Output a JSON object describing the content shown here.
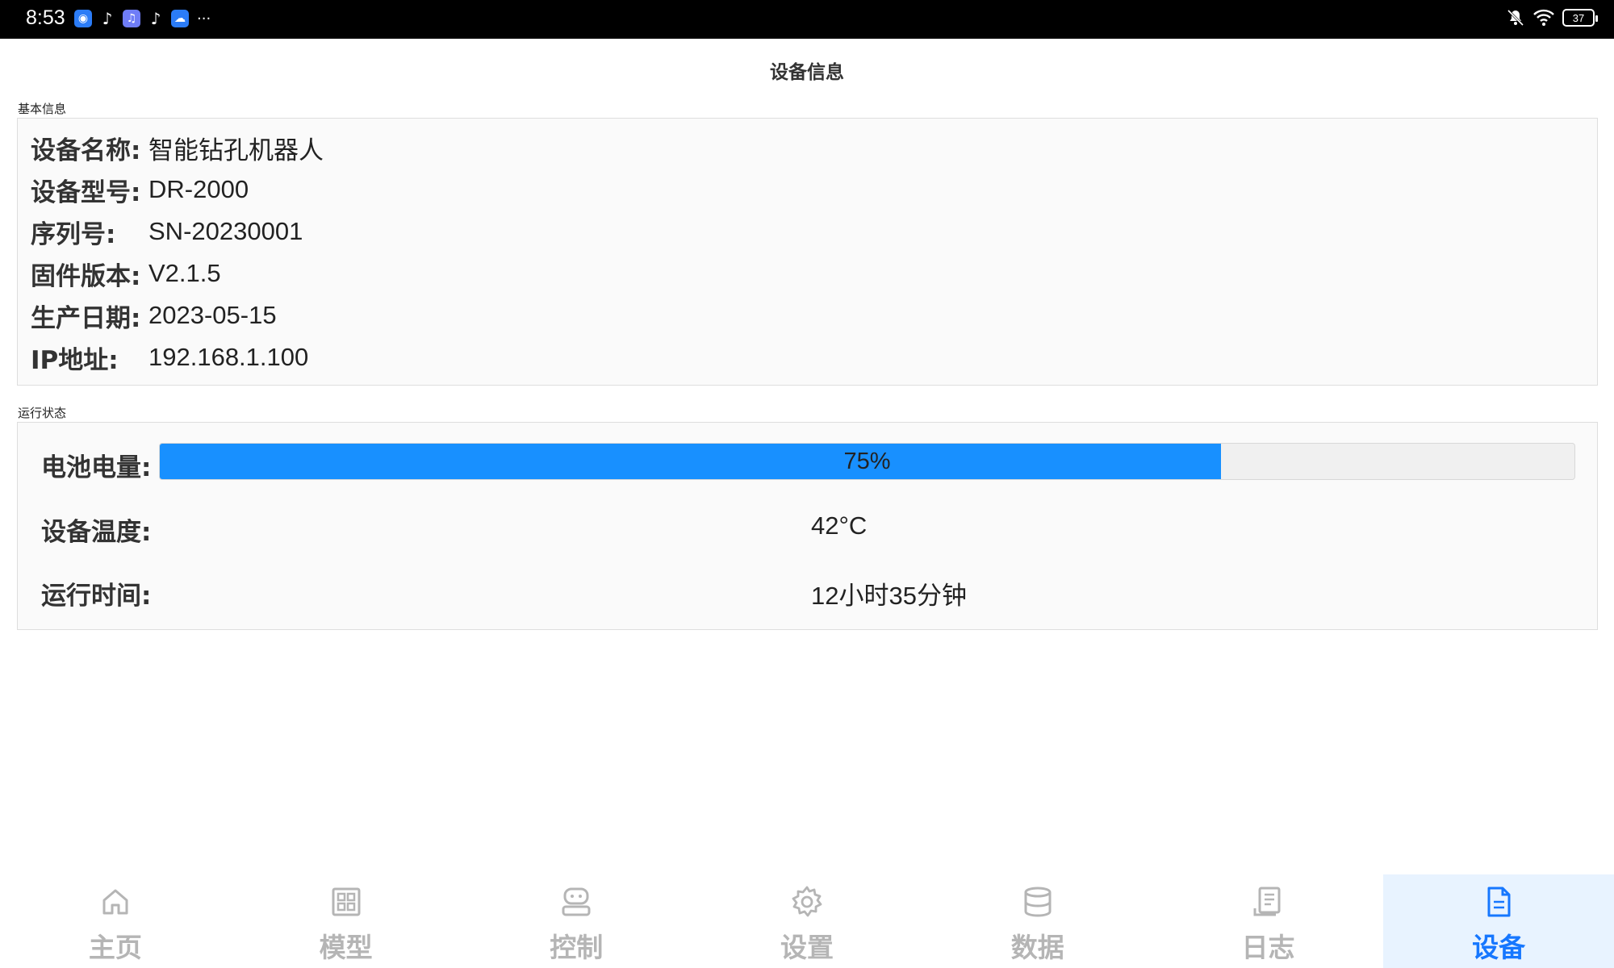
{
  "status_bar": {
    "time": "8:53",
    "apps": [
      "browser-icon",
      "tiktok-icon",
      "music-icon",
      "tiktok-icon",
      "cloud-icon"
    ],
    "more": "···",
    "battery": "37"
  },
  "header": {
    "title": "设备信息"
  },
  "basic_info": {
    "section_label": "基本信息",
    "rows": [
      {
        "key": "设备名称:",
        "value": "智能钻孔机器人"
      },
      {
        "key": "设备型号:",
        "value": "DR-2000"
      },
      {
        "key": "序列号:",
        "value": "SN-20230001"
      },
      {
        "key": "固件版本:",
        "value": "V2.1.5"
      },
      {
        "key": "生产日期:",
        "value": "2023-05-15"
      },
      {
        "key": "IP地址:",
        "value": "192.168.1.100"
      }
    ]
  },
  "run_status": {
    "section_label": "运行状态",
    "battery_label": "电池电量:",
    "battery_percent": 75,
    "battery_text": "75%",
    "temp_label": "设备温度:",
    "temp_value": "42°C",
    "uptime_label": "运行时间:",
    "uptime_value": "12小时35分钟"
  },
  "nav": {
    "items": [
      {
        "label": "主页",
        "icon": "home-icon"
      },
      {
        "label": "模型",
        "icon": "grid-icon"
      },
      {
        "label": "控制",
        "icon": "robot-icon"
      },
      {
        "label": "设置",
        "icon": "gear-icon"
      },
      {
        "label": "数据",
        "icon": "database-icon"
      },
      {
        "label": "日志",
        "icon": "log-icon"
      },
      {
        "label": "设备",
        "icon": "document-icon"
      }
    ],
    "active_index": 6
  },
  "colors": {
    "accent": "#1677ff",
    "progress": "#1890ff",
    "active_bg": "#e8f3ff",
    "inactive": "#b5b5b5"
  }
}
